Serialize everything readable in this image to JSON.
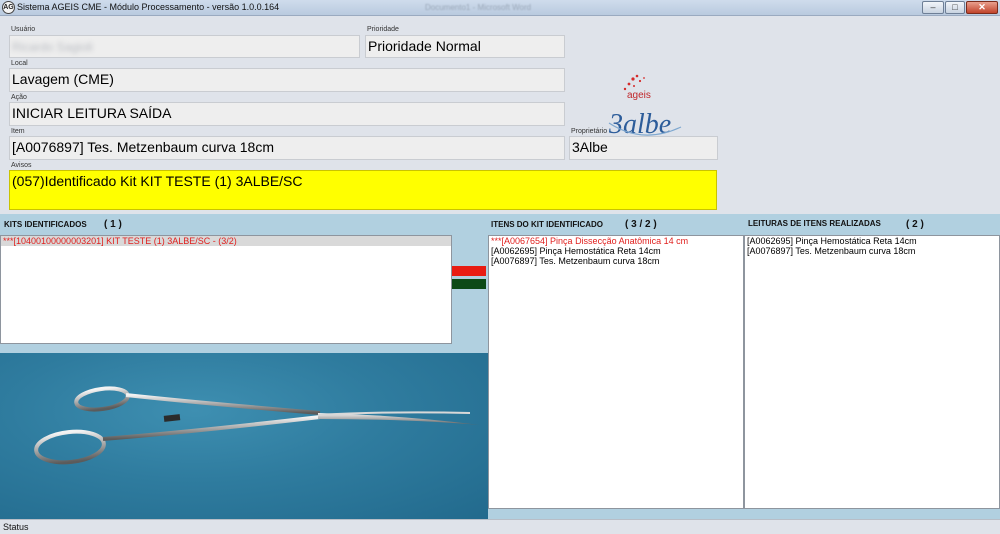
{
  "window": {
    "title": "Sistema AGEIS CME - Módulo Processamento - versão 1.0.0.164",
    "taskbar_hint_1": "Documento1 - Microsoft Word",
    "icon_text": "AG"
  },
  "form": {
    "usuario_label": "Usuário",
    "usuario_value": "Ricardo Sagioli",
    "prioridade_label": "Prioridade",
    "prioridade_value": "Prioridade Normal",
    "local_label": "Local",
    "local_value": "Lavagem (CME)",
    "acao_label": "Ação",
    "acao_value": "INICIAR LEITURA SAÍDA",
    "item_label": "Item",
    "item_value": "[A0076897] Tes. Metzenbaum curva 18cm",
    "proprietario_label": "Proprietário",
    "proprietario_value": "3Albe",
    "avisos_label": "Avisos",
    "avisos_value": "(057)Identificado Kit KIT TESTE (1) 3ALBE/SC"
  },
  "logo": {
    "brand_top": "ageis",
    "brand_main": "3albe"
  },
  "kits": {
    "title": "KITS IDENTIFICADOS",
    "count": "( 1 )",
    "items": [
      {
        "text": "***[10400100000003201] KIT TESTE (1) 3ALBE/SC - (3/2)",
        "red": true,
        "selected": true
      }
    ]
  },
  "itens_kit": {
    "title": "ITENS DO KIT IDENTIFICADO",
    "count": "( 3 / 2 )",
    "items": [
      {
        "text": "***[A0067654] Pinça Dissecção Anatômica 14 cm",
        "red": true
      },
      {
        "text": "[A0062695] Pinça Hemostática Reta 14cm",
        "red": false
      },
      {
        "text": "[A0076897] Tes. Metzenbaum curva 18cm",
        "red": false
      }
    ]
  },
  "leituras": {
    "title": "LEITURAS DE ITENS  REALIZADAS",
    "count": "( 2 )",
    "items": [
      {
        "text": "[A0062695] Pinça Hemostática Reta 14cm",
        "red": false
      },
      {
        "text": "[A0076897] Tes. Metzenbaum curva 18cm",
        "red": false
      }
    ]
  },
  "indicators": {
    "red": "#e81c12",
    "green": "#0c4a17"
  },
  "icons": {
    "minimize": "minimize-icon",
    "maximize": "maximize-icon",
    "close": "close-icon"
  },
  "status": {
    "text": "Status"
  }
}
